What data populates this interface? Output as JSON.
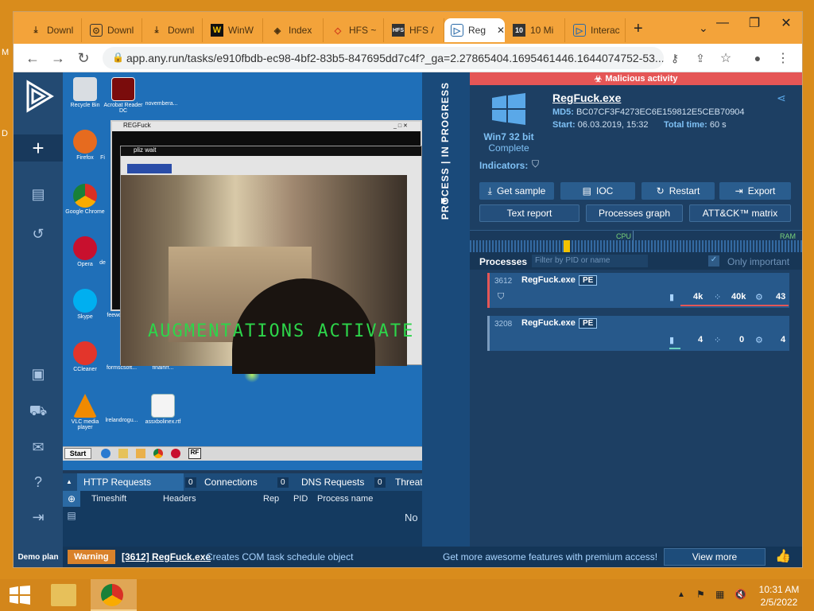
{
  "browser": {
    "tabs": [
      {
        "label": "Downl",
        "icon": "download-icon"
      },
      {
        "label": "Downl",
        "icon": "download-icon"
      },
      {
        "label": "Downl",
        "icon": "download-icon"
      },
      {
        "label": "WinW",
        "icon": "winrar-icon"
      },
      {
        "label": "Index",
        "icon": "index-icon"
      },
      {
        "label": "HFS ~",
        "icon": "hfs-icon"
      },
      {
        "label": "HFS /",
        "icon": "hfs-icon"
      },
      {
        "label": "Reg",
        "icon": "anyrun-icon",
        "active": true
      },
      {
        "label": "10 Mi",
        "icon": "10min-icon"
      },
      {
        "label": "Interac",
        "icon": "anyrun-icon"
      }
    ],
    "new_tab": "+",
    "url": "app.any.run/tasks/e910fbdb-ec98-4bf2-83b5-847695dd7c4f?_ga=2.27865404.1695461446.1644074752-53..."
  },
  "vm": {
    "desktop_icons": [
      {
        "label": "Recycle Bin"
      },
      {
        "label": "Acrobat Reader DC"
      },
      {
        "label": "novembera..."
      },
      {
        "label": "Firefox"
      },
      {
        "label": "Fi"
      },
      {
        "label": "Google Chrome"
      },
      {
        "label": "Opera"
      },
      {
        "label": "de"
      },
      {
        "label": "Skype"
      },
      {
        "label": "feeworgy.l..."
      },
      {
        "label": "CCleaner"
      },
      {
        "label": "formscsoft..."
      },
      {
        "label": "finalhrf..."
      },
      {
        "label": "VLC media player"
      },
      {
        "label": "lrelandrogu..."
      },
      {
        "label": "assxbolinex.rtf"
      }
    ],
    "regfuck_title": "REGFuck",
    "pliz_title": "pliz wait",
    "augment_text": "AUGMENTATIONS ACTIVATE",
    "start_label": "Start"
  },
  "lower_tabs": [
    {
      "label": "HTTP Requests",
      "count": "0"
    },
    {
      "label": "Connections",
      "count": "0"
    },
    {
      "label": "DNS Requests",
      "count": "0"
    },
    {
      "label": "Threat",
      "count": ""
    }
  ],
  "lower_headers": [
    "Timeshift",
    "Headers",
    "Rep",
    "PID",
    "Process name"
  ],
  "lower_empty": "No",
  "strip_text": "PROCESS | IN PROGRESS",
  "right": {
    "malicious": "Malicious activity",
    "filename": "RegFuck.exe",
    "md5_label": "MD5:",
    "md5": "BC07CF3F4273EC6E159812E5CEB70904",
    "start_label": "Start:",
    "start": "06.03.2019, 15:32",
    "total_label": "Total time:",
    "total": "60 s",
    "os": "Win7 32 bit",
    "os_status": "Complete",
    "indicators": "Indicators:",
    "buttons": [
      "Get sample",
      "IOC",
      "Restart",
      "Export"
    ],
    "buttons2": [
      "Text report",
      "Processes graph",
      "ATT&CK™ matrix"
    ],
    "cpu": "CPU",
    "ram": "RAM",
    "processes_label": "Processes",
    "filter_placeholder": "Filter by PID or name",
    "only_important": "Only important",
    "processes": [
      {
        "pid": "3612",
        "name": "RegFuck.exe",
        "badge": "PE",
        "files": "4k",
        "reg": "40k",
        "net": "43"
      },
      {
        "pid": "3208",
        "name": "RegFuck.exe",
        "badge": "PE",
        "files": "4",
        "reg": "0",
        "net": "4"
      }
    ]
  },
  "status": {
    "demo": "Demo plan",
    "warning": "Warning",
    "proc": "[3612] RegFuck.exe",
    "message": "Creates COM task schedule object",
    "premium": "Get more awesome features with premium access!",
    "view_more": "View more"
  },
  "taskbar": {
    "time": "10:31 AM",
    "date": "2/5/2022"
  },
  "colors": {
    "accent_orange": "#d98c1c",
    "anyrun_bg": "#1d3f63",
    "malicious": "#e55656"
  }
}
